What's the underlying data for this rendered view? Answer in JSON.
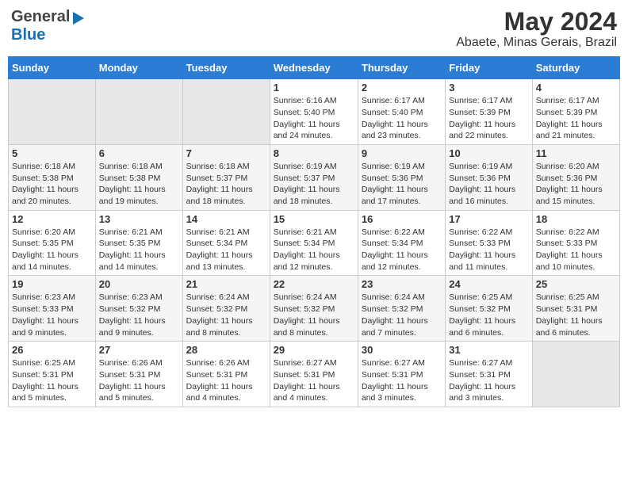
{
  "header": {
    "logo_general": "General",
    "logo_blue": "Blue",
    "month_year": "May 2024",
    "location": "Abaete, Minas Gerais, Brazil"
  },
  "weekdays": [
    "Sunday",
    "Monday",
    "Tuesday",
    "Wednesday",
    "Thursday",
    "Friday",
    "Saturday"
  ],
  "weeks": [
    [
      {
        "day": "",
        "sunrise": "",
        "sunset": "",
        "daylight": "",
        "empty": true
      },
      {
        "day": "",
        "sunrise": "",
        "sunset": "",
        "daylight": "",
        "empty": true
      },
      {
        "day": "",
        "sunrise": "",
        "sunset": "",
        "daylight": "",
        "empty": true
      },
      {
        "day": "1",
        "sunrise": "Sunrise: 6:16 AM",
        "sunset": "Sunset: 5:40 PM",
        "daylight": "Daylight: 11 hours and 24 minutes."
      },
      {
        "day": "2",
        "sunrise": "Sunrise: 6:17 AM",
        "sunset": "Sunset: 5:40 PM",
        "daylight": "Daylight: 11 hours and 23 minutes."
      },
      {
        "day": "3",
        "sunrise": "Sunrise: 6:17 AM",
        "sunset": "Sunset: 5:39 PM",
        "daylight": "Daylight: 11 hours and 22 minutes."
      },
      {
        "day": "4",
        "sunrise": "Sunrise: 6:17 AM",
        "sunset": "Sunset: 5:39 PM",
        "daylight": "Daylight: 11 hours and 21 minutes."
      }
    ],
    [
      {
        "day": "5",
        "sunrise": "Sunrise: 6:18 AM",
        "sunset": "Sunset: 5:38 PM",
        "daylight": "Daylight: 11 hours and 20 minutes."
      },
      {
        "day": "6",
        "sunrise": "Sunrise: 6:18 AM",
        "sunset": "Sunset: 5:38 PM",
        "daylight": "Daylight: 11 hours and 19 minutes."
      },
      {
        "day": "7",
        "sunrise": "Sunrise: 6:18 AM",
        "sunset": "Sunset: 5:37 PM",
        "daylight": "Daylight: 11 hours and 18 minutes."
      },
      {
        "day": "8",
        "sunrise": "Sunrise: 6:19 AM",
        "sunset": "Sunset: 5:37 PM",
        "daylight": "Daylight: 11 hours and 18 minutes."
      },
      {
        "day": "9",
        "sunrise": "Sunrise: 6:19 AM",
        "sunset": "Sunset: 5:36 PM",
        "daylight": "Daylight: 11 hours and 17 minutes."
      },
      {
        "day": "10",
        "sunrise": "Sunrise: 6:19 AM",
        "sunset": "Sunset: 5:36 PM",
        "daylight": "Daylight: 11 hours and 16 minutes."
      },
      {
        "day": "11",
        "sunrise": "Sunrise: 6:20 AM",
        "sunset": "Sunset: 5:36 PM",
        "daylight": "Daylight: 11 hours and 15 minutes."
      }
    ],
    [
      {
        "day": "12",
        "sunrise": "Sunrise: 6:20 AM",
        "sunset": "Sunset: 5:35 PM",
        "daylight": "Daylight: 11 hours and 14 minutes."
      },
      {
        "day": "13",
        "sunrise": "Sunrise: 6:21 AM",
        "sunset": "Sunset: 5:35 PM",
        "daylight": "Daylight: 11 hours and 14 minutes."
      },
      {
        "day": "14",
        "sunrise": "Sunrise: 6:21 AM",
        "sunset": "Sunset: 5:34 PM",
        "daylight": "Daylight: 11 hours and 13 minutes."
      },
      {
        "day": "15",
        "sunrise": "Sunrise: 6:21 AM",
        "sunset": "Sunset: 5:34 PM",
        "daylight": "Daylight: 11 hours and 12 minutes."
      },
      {
        "day": "16",
        "sunrise": "Sunrise: 6:22 AM",
        "sunset": "Sunset: 5:34 PM",
        "daylight": "Daylight: 11 hours and 12 minutes."
      },
      {
        "day": "17",
        "sunrise": "Sunrise: 6:22 AM",
        "sunset": "Sunset: 5:33 PM",
        "daylight": "Daylight: 11 hours and 11 minutes."
      },
      {
        "day": "18",
        "sunrise": "Sunrise: 6:22 AM",
        "sunset": "Sunset: 5:33 PM",
        "daylight": "Daylight: 11 hours and 10 minutes."
      }
    ],
    [
      {
        "day": "19",
        "sunrise": "Sunrise: 6:23 AM",
        "sunset": "Sunset: 5:33 PM",
        "daylight": "Daylight: 11 hours and 9 minutes."
      },
      {
        "day": "20",
        "sunrise": "Sunrise: 6:23 AM",
        "sunset": "Sunset: 5:32 PM",
        "daylight": "Daylight: 11 hours and 9 minutes."
      },
      {
        "day": "21",
        "sunrise": "Sunrise: 6:24 AM",
        "sunset": "Sunset: 5:32 PM",
        "daylight": "Daylight: 11 hours and 8 minutes."
      },
      {
        "day": "22",
        "sunrise": "Sunrise: 6:24 AM",
        "sunset": "Sunset: 5:32 PM",
        "daylight": "Daylight: 11 hours and 8 minutes."
      },
      {
        "day": "23",
        "sunrise": "Sunrise: 6:24 AM",
        "sunset": "Sunset: 5:32 PM",
        "daylight": "Daylight: 11 hours and 7 minutes."
      },
      {
        "day": "24",
        "sunrise": "Sunrise: 6:25 AM",
        "sunset": "Sunset: 5:32 PM",
        "daylight": "Daylight: 11 hours and 6 minutes."
      },
      {
        "day": "25",
        "sunrise": "Sunrise: 6:25 AM",
        "sunset": "Sunset: 5:31 PM",
        "daylight": "Daylight: 11 hours and 6 minutes."
      }
    ],
    [
      {
        "day": "26",
        "sunrise": "Sunrise: 6:25 AM",
        "sunset": "Sunset: 5:31 PM",
        "daylight": "Daylight: 11 hours and 5 minutes."
      },
      {
        "day": "27",
        "sunrise": "Sunrise: 6:26 AM",
        "sunset": "Sunset: 5:31 PM",
        "daylight": "Daylight: 11 hours and 5 minutes."
      },
      {
        "day": "28",
        "sunrise": "Sunrise: 6:26 AM",
        "sunset": "Sunset: 5:31 PM",
        "daylight": "Daylight: 11 hours and 4 minutes."
      },
      {
        "day": "29",
        "sunrise": "Sunrise: 6:27 AM",
        "sunset": "Sunset: 5:31 PM",
        "daylight": "Daylight: 11 hours and 4 minutes."
      },
      {
        "day": "30",
        "sunrise": "Sunrise: 6:27 AM",
        "sunset": "Sunset: 5:31 PM",
        "daylight": "Daylight: 11 hours and 3 minutes."
      },
      {
        "day": "31",
        "sunrise": "Sunrise: 6:27 AM",
        "sunset": "Sunset: 5:31 PM",
        "daylight": "Daylight: 11 hours and 3 minutes."
      },
      {
        "day": "",
        "sunrise": "",
        "sunset": "",
        "daylight": "",
        "empty": true
      }
    ]
  ]
}
